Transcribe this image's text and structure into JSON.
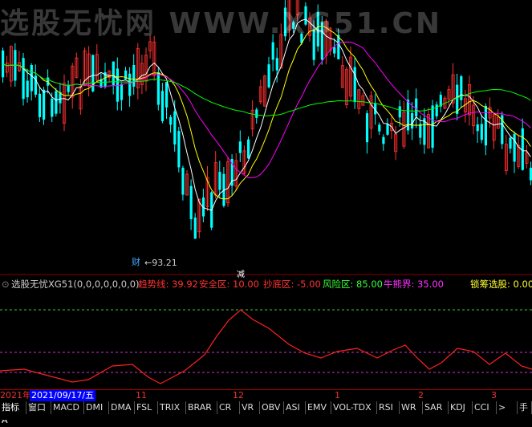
{
  "watermark": "选股无忧网 WWW.XG51.CN",
  "main_chart": {
    "low_label": "←93.21",
    "markers": [
      "财",
      "减"
    ]
  },
  "indicator": {
    "name": "选股无忧XG51(0,0,0,0,0,0,0)",
    "items": [
      {
        "label": "趋势线:",
        "value": "39.92",
        "color": "#ff3333"
      },
      {
        "label": "安全区:",
        "value": "10.00",
        "color": "#ff3333"
      },
      {
        "label": "抄底区:",
        "value": "-5.00",
        "color": "#ff3333"
      },
      {
        "label": "风险区:",
        "value": "85.00",
        "color": "#33ff33"
      },
      {
        "label": "牛熊界:",
        "value": "35.00",
        "color": "#ff33ff"
      },
      {
        "label": "锁筹选股:",
        "value": "0.00",
        "color": "#ffff33"
      }
    ]
  },
  "time_axis": {
    "year": "2021年",
    "cursor_date": "2021/09/17/五",
    "ticks": [
      "11",
      "12",
      "1",
      "2",
      "3"
    ]
  },
  "tabs": [
    "指标A",
    "窗口",
    "MACD",
    "DMI",
    "DMA",
    "FSL",
    "TRIX",
    "BRAR",
    "CR",
    "VR",
    "OBV",
    "ASI",
    "EMV",
    "VOL-TDX",
    "RSI",
    "WR",
    "SAR",
    "KDJ",
    "CCI",
    ">",
    "手"
  ],
  "colors": {
    "up": "#ff3030",
    "down": "#00ffff",
    "ma5": "#ffffff",
    "ma10": "#ffff00",
    "ma20": "#ff00ff",
    "ma60": "#00ff00",
    "trend": "#ff2020"
  }
}
